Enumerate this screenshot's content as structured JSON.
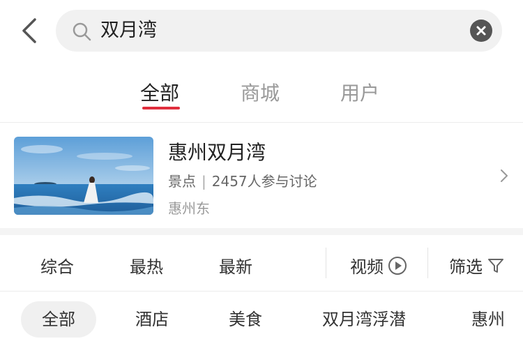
{
  "search": {
    "query": "双月湾"
  },
  "tabs": [
    {
      "label": "全部",
      "active": true
    },
    {
      "label": "商城",
      "active": false
    },
    {
      "label": "用户",
      "active": false
    }
  ],
  "poi": {
    "title": "惠州双月湾",
    "category": "景点",
    "separator": "|",
    "discussion": "2457人参与讨论",
    "location": "惠州东"
  },
  "sort_bar": {
    "items": [
      "综合",
      "最热",
      "最新"
    ],
    "video_label": "视频",
    "filter_label": "筛选"
  },
  "chips": [
    {
      "label": "全部",
      "active": true
    },
    {
      "label": "酒店",
      "active": false
    },
    {
      "label": "美食",
      "active": false
    },
    {
      "label": "双月湾浮潜",
      "active": false
    },
    {
      "label": "惠州",
      "active": false
    }
  ],
  "colors": {
    "accent": "#e02e3d",
    "search_bg": "#f1f1f1",
    "chip_bg": "#f0f0f0"
  }
}
